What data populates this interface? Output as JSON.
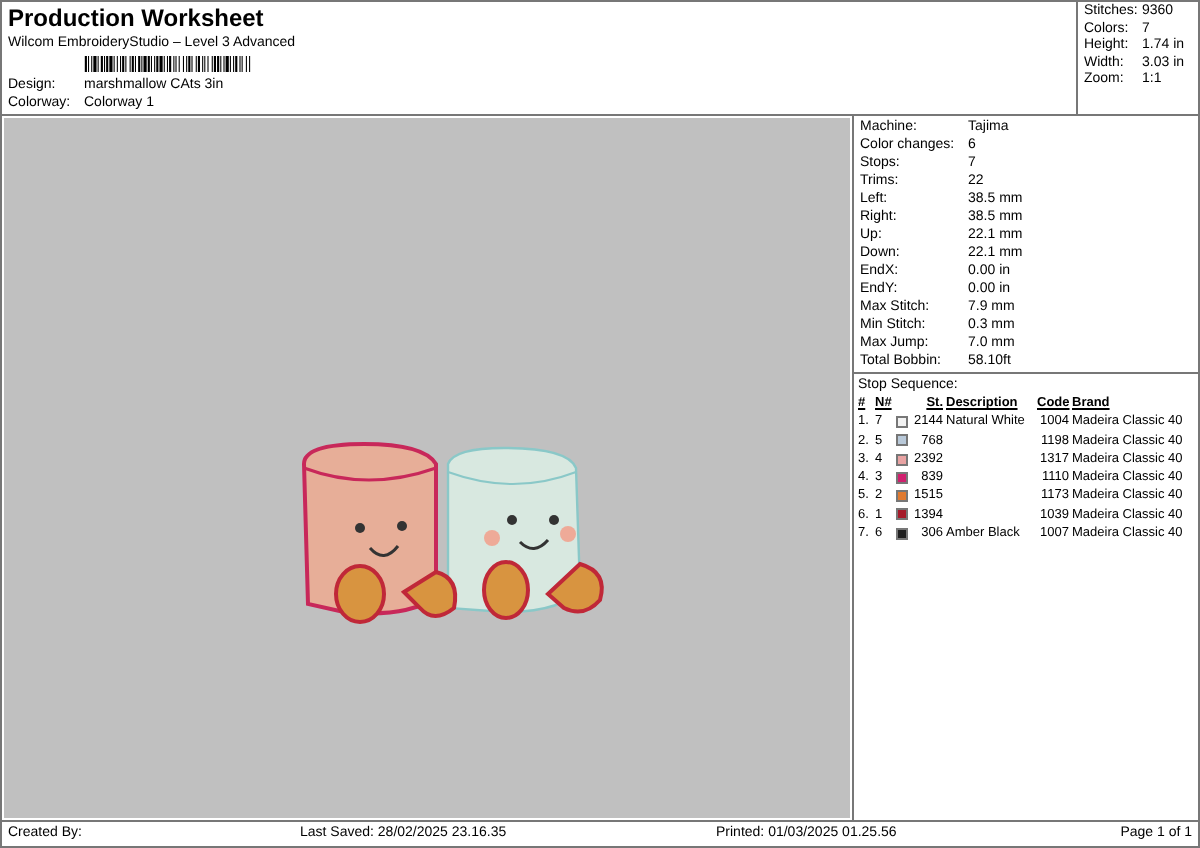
{
  "header": {
    "title": "Production Worksheet",
    "subtitle": "Wilcom EmbroideryStudio – Level 3 Advanced",
    "fields": [
      {
        "label": "Design:",
        "value": "marshmallow CAts 3in"
      },
      {
        "label": "Colorway:",
        "value": "Colorway 1"
      }
    ]
  },
  "stats": [
    {
      "label": "Stitches:",
      "value": "9360"
    },
    {
      "label": "Colors:",
      "value": "7"
    },
    {
      "label": "Height:",
      "value": "1.74 in"
    },
    {
      "label": "Width:",
      "value": "3.03 in"
    },
    {
      "label": "Zoom:",
      "value": "1:1"
    }
  ],
  "machine_info": [
    {
      "label": "Machine:",
      "value": "Tajima"
    },
    {
      "label": "Color changes:",
      "value": "6"
    },
    {
      "label": "Stops:",
      "value": "7"
    },
    {
      "label": "Trims:",
      "value": "22"
    },
    {
      "label": "Left:",
      "value": "38.5 mm"
    },
    {
      "label": "Right:",
      "value": "38.5 mm"
    },
    {
      "label": "Up:",
      "value": "22.1 mm"
    },
    {
      "label": "Down:",
      "value": "22.1 mm"
    },
    {
      "label": "EndX:",
      "value": "0.00 in"
    },
    {
      "label": "EndY:",
      "value": "0.00 in"
    },
    {
      "label": "Max Stitch:",
      "value": "7.9 mm"
    },
    {
      "label": "Min Stitch:",
      "value": "0.3 mm"
    },
    {
      "label": "Max Jump:",
      "value": "7.0 mm"
    },
    {
      "label": "Total Bobbin:",
      "value": "58.10ft"
    }
  ],
  "stop_sequence": {
    "title": "Stop Sequence:",
    "columns": [
      "#",
      "N#",
      "St.",
      "Description",
      "Code",
      "Brand"
    ],
    "rows": [
      {
        "index": "1.",
        "needle": "7",
        "color": "#f2f2f2",
        "stitches": "2144",
        "description": "Natural White",
        "code": "1004",
        "brand": "Madeira Classic 40"
      },
      {
        "index": "2.",
        "needle": "5",
        "color": "#b9c9d9",
        "stitches": "768",
        "code": "1198",
        "brand": "Madeira Classic 40"
      },
      {
        "index": "3.",
        "needle": "4",
        "color": "#e9a3a3",
        "stitches": "2392",
        "code": "1317",
        "brand": "Madeira Classic 40"
      },
      {
        "index": "4.",
        "needle": "3",
        "color": "#d0206e",
        "stitches": "839",
        "code": "1110",
        "brand": "Madeira Classic 40"
      },
      {
        "index": "5.",
        "needle": "2",
        "color": "#e07a30",
        "stitches": "1515",
        "code": "1173",
        "brand": "Madeira Classic 40"
      },
      {
        "index": "6.",
        "needle": "1",
        "color": "#a51a2a",
        "stitches": "1394",
        "code": "1039",
        "brand": "Madeira Classic 40"
      },
      {
        "index": "7.",
        "needle": "6",
        "color": "#202020",
        "stitches": "306",
        "description": "Amber Black",
        "code": "1007",
        "brand": "Madeira Classic 40"
      }
    ]
  },
  "footer": {
    "created_by": "Created By:",
    "last_saved": "Last Saved: 28/02/2025 23.16.35",
    "printed": "Printed: 01/03/2025 01.25.56",
    "page": "Page 1 of 1"
  }
}
